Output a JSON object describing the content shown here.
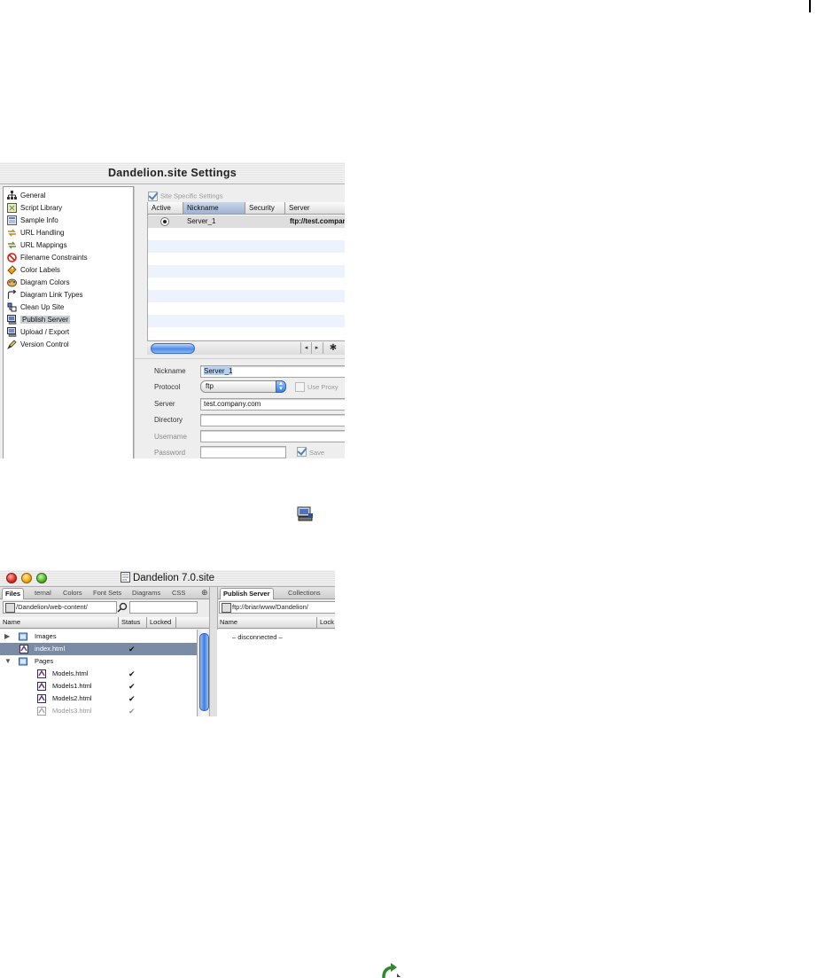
{
  "settings_window": {
    "title": "Dandelion.site Settings",
    "sidebar": [
      {
        "label": "General",
        "icon": "sitemap-icon"
      },
      {
        "label": "Script Library",
        "icon": "script-library-icon"
      },
      {
        "label": "Sample Info",
        "icon": "sample-info-icon"
      },
      {
        "label": "URL Handling",
        "icon": "url-handling-icon"
      },
      {
        "label": "URL Mappings",
        "icon": "url-mappings-icon"
      },
      {
        "label": "Filename Constraints",
        "icon": "no-entry-icon"
      },
      {
        "label": "Color Labels",
        "icon": "color-labels-icon"
      },
      {
        "label": "Diagram Colors",
        "icon": "palette-icon"
      },
      {
        "label": "Diagram Link Types",
        "icon": "link-arrow-icon"
      },
      {
        "label": "Clean Up Site",
        "icon": "cleanup-icon"
      },
      {
        "label": "Publish Server",
        "icon": "publish-server-icon",
        "selected": true
      },
      {
        "label": "Upload / Export",
        "icon": "upload-icon"
      },
      {
        "label": "Version Control",
        "icon": "version-control-icon"
      }
    ],
    "site_specific_label": "Site Specific Settings",
    "table": {
      "headers": [
        "Active",
        "Nickname",
        "Security",
        "Server"
      ],
      "rows": [
        {
          "active": true,
          "nickname": "Server_1",
          "security": "",
          "server": "ftp://test.compar"
        }
      ]
    },
    "form": {
      "nickname_label": "Nickname",
      "nickname_value": "Server_1",
      "protocol_label": "Protocol",
      "protocol_value": "ftp",
      "use_proxy_label": "Use Proxy",
      "server_label": "Server",
      "server_value": "test.company.com",
      "directory_label": "Directory",
      "username_label": "Username",
      "password_label": "Password",
      "save_label": "Save"
    }
  },
  "site_window": {
    "title": "Dandelion 7.0.site",
    "tabs": [
      "Files",
      "ternal",
      "Colors",
      "Font Sets",
      "Diagrams",
      "CSS"
    ],
    "right_tabs": [
      "Publish Server",
      "Collections"
    ],
    "local_path": "/Dandelion/web-content/",
    "remote_path": "ftp://briar/www/Dandelion/",
    "columns": {
      "name": "Name",
      "status": "Status",
      "locked": "Locked"
    },
    "right_columns": {
      "name": "Name",
      "lock": "Lock"
    },
    "files": [
      {
        "name": "Images",
        "type": "folder",
        "expanded": false,
        "indent": 0,
        "status": ""
      },
      {
        "name": "index.html",
        "type": "file",
        "indent": 0,
        "status": "✔",
        "selected": true
      },
      {
        "name": "Pages",
        "type": "folder",
        "expanded": true,
        "indent": 0,
        "status": ""
      },
      {
        "name": "Models.html",
        "type": "file",
        "indent": 1,
        "status": "✔"
      },
      {
        "name": "Models1.html",
        "type": "file",
        "indent": 1,
        "status": "✔"
      },
      {
        "name": "Models2.html",
        "type": "file",
        "indent": 1,
        "status": "✔"
      },
      {
        "name": "Models3.html",
        "type": "file",
        "indent": 1,
        "status": "✔"
      }
    ],
    "remote_status": "– disconnected –"
  },
  "colors": {
    "selection": "#7a8ca5",
    "aqua_blue": "#3d7fe0",
    "stripe": "#edf3fe"
  }
}
